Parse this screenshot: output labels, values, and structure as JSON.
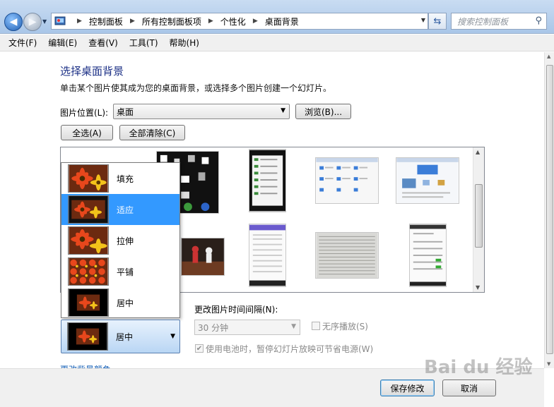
{
  "address": {
    "crumbs": [
      "控制面板",
      "所有控制面板项",
      "个性化",
      "桌面背景"
    ],
    "search_placeholder": "搜索控制面板"
  },
  "menu": [
    "文件(F)",
    "编辑(E)",
    "查看(V)",
    "工具(T)",
    "帮助(H)"
  ],
  "page": {
    "heading": "选择桌面背景",
    "description": "单击某个图片使其成为您的桌面背景，或选择多个图片创建一个幻灯片。",
    "location_label": "图片位置(L):",
    "location_value": "桌面",
    "browse_label": "浏览(B)...",
    "select_all_label": "全选(A)",
    "clear_all_label": "全部清除(C)"
  },
  "position": {
    "options": [
      "填充",
      "适应",
      "拉伸",
      "平铺",
      "居中"
    ],
    "selected_index": 1,
    "current": "居中"
  },
  "slideshow": {
    "interval_label": "更改图片时间间隔(N):",
    "interval_value": "30 分钟",
    "shuffle_label": "无序播放(S)",
    "battery_label": "使用电池时，暂停幻灯片放映可节省电源(W)",
    "battery_checked": true
  },
  "change_color_label": "更改背景颜色",
  "footer": {
    "save_label": "保存修改",
    "cancel_label": "取消"
  },
  "watermark": "Bai du 经验"
}
